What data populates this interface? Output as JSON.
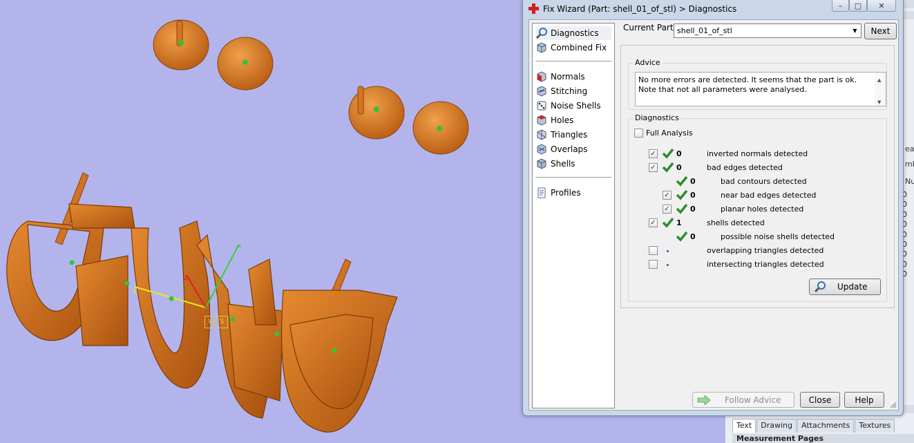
{
  "window": {
    "title": "Fix Wizard (Part: shell_01_of_stl) > Diagnostics",
    "controls": {
      "minimize": "–",
      "maximize": "□",
      "close": "✕"
    }
  },
  "nav": {
    "items": [
      {
        "label": "Diagnostics",
        "icon": "magnifier-icon",
        "selected": true
      },
      {
        "label": "Combined Fix",
        "icon": "cube-icon"
      },
      {
        "label": "Normals",
        "icon": "cube-red-face-icon"
      },
      {
        "label": "Stitching",
        "icon": "cube-stitch-icon"
      },
      {
        "label": "Noise Shells",
        "icon": "dice-icon"
      },
      {
        "label": "Holes",
        "icon": "cube-hole-icon"
      },
      {
        "label": "Triangles",
        "icon": "triangle-icon"
      },
      {
        "label": "Overlaps",
        "icon": "overlap-icon"
      },
      {
        "label": "Shells",
        "icon": "shells-icon"
      },
      {
        "label": "Profiles",
        "icon": "document-icon"
      }
    ]
  },
  "part": {
    "label": "Current Part:",
    "value": "shell_01_of_stl",
    "next_label": "Next"
  },
  "advice": {
    "title": "Advice",
    "text": "No more errors are detected. It seems that the part is ok. Note that not all parameters were analysed."
  },
  "diagnostics": {
    "title": "Diagnostics",
    "full_analysis_label": "Full Analysis",
    "rows": [
      {
        "count": "0",
        "label": "inverted normals detected",
        "checked": true,
        "ok": true
      },
      {
        "count": "0",
        "label": "bad edges detected",
        "checked": true,
        "ok": true
      },
      {
        "count": "0",
        "label": "bad contours detected",
        "checked": null,
        "ok": true
      },
      {
        "count": "0",
        "label": "near bad edges detected",
        "checked": true,
        "ok": true
      },
      {
        "count": "0",
        "label": "planar holes detected",
        "checked": true,
        "ok": true
      },
      {
        "count": "1",
        "label": "shells detected",
        "checked": true,
        "ok": true
      },
      {
        "count": "0",
        "label": "possible noise shells detected",
        "checked": null,
        "ok": true
      },
      {
        "count": "",
        "label": "overlapping triangles detected",
        "checked": false,
        "ok": false
      },
      {
        "count": "",
        "label": "intersecting triangles detected",
        "checked": false,
        "ok": false
      }
    ],
    "update_label": "Update"
  },
  "buttons": {
    "follow_advice": "Follow Advice",
    "close": "Close",
    "help": "Help"
  },
  "background_app": {
    "tabs": [
      "Text",
      "Drawing",
      "Attachments",
      "Textures"
    ],
    "measurement_header": "Measurement Pages",
    "side_fragments": [
      "ean",
      "mbe",
      "Nu"
    ],
    "number_column": [
      "0",
      "0",
      "0",
      "0",
      "0",
      "0",
      "0",
      "0",
      "0"
    ]
  },
  "viewport": {
    "wcs_label": "WCS",
    "axis_x_label": "x",
    "axis_y_label": "y",
    "axis_z_label": "z"
  },
  "colors": {
    "background": "#b4b4ec",
    "model": "#d77a23",
    "accent_green": "#2e8b2e"
  }
}
